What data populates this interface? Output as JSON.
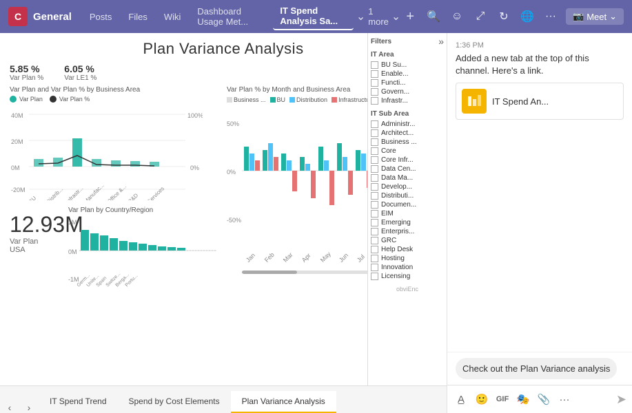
{
  "app": {
    "icon": "C",
    "team_name": "General",
    "nav_tabs": [
      {
        "label": "Posts",
        "active": false
      },
      {
        "label": "Files",
        "active": false
      },
      {
        "label": "Wiki",
        "active": false
      },
      {
        "label": "Dashboard Usage Met...",
        "active": false
      },
      {
        "label": "IT Spend Analysis Sa...",
        "active": true
      },
      {
        "label": "1 more",
        "active": false
      }
    ],
    "meet_label": "Meet"
  },
  "report": {
    "title": "Plan Variance Analysis",
    "metrics": [
      {
        "value": "5.85 %",
        "label": "Var Plan %"
      },
      {
        "value": "6.05 %",
        "label": "Var LE1 %"
      }
    ],
    "var_plan_chart_label": "Var Plan and Var Plan % by Business Area",
    "bar_chart_label": "Var Plan % by Month and Business Area",
    "country_chart_label": "Var Plan by Country/Region",
    "big_number": "12.93M",
    "big_number_label": "Var Plan",
    "big_number_sublabel": "USA",
    "legend": [
      "Business ...",
      "BU",
      "Distribution",
      "Infrastructure"
    ],
    "filters_title": "Filters",
    "filter_sections": [
      {
        "title": "IT Area",
        "items": [
          "BU Su...",
          "Enable...",
          "Functi...",
          "Govern...",
          "Infrastr..."
        ]
      },
      {
        "title": "IT Sub Area",
        "items": [
          "Administr...",
          "Architect...",
          "Business ...",
          "Core",
          "Core Infr...",
          "Data Cen...",
          "Data Ma...",
          "Develop...",
          "Distributi...",
          "Documen...",
          "EIM",
          "Emerging",
          "Enterpris...",
          "GRC",
          "Help Desk",
          "Hosting",
          "Innovation",
          "Licensing"
        ]
      }
    ]
  },
  "bottom_tabs": [
    {
      "label": "IT Spend Trend",
      "active": false
    },
    {
      "label": "Spend by Cost Elements",
      "active": false
    },
    {
      "label": "Plan Variance Analysis",
      "active": true
    }
  ],
  "chat": {
    "time": "1:36 PM",
    "message": "Added a new tab at the top of this channel. Here's a link.",
    "card_title": "IT Spend An...",
    "bottom_message": "Check out the Plan Variance analysis",
    "toolbar_icons": [
      "format",
      "emoji",
      "gif",
      "sticker",
      "attach",
      "more"
    ],
    "send_icon": "send"
  }
}
